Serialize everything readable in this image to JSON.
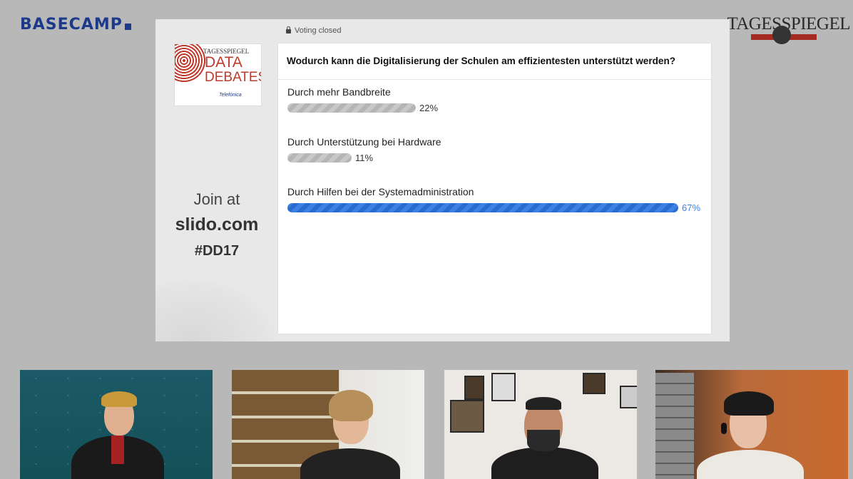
{
  "brand_left": "BASECAMP",
  "brand_right": "TAGESSPIEGEL",
  "slido": {
    "status": "Voting closed",
    "logo": {
      "publisher": "TAGESSPIEGEL",
      "line1": "DATA",
      "line2": "DEBATES",
      "sponsor": "Telefónica"
    },
    "join": {
      "prompt": "Join at",
      "url": "slido.com",
      "code": "#DD17"
    },
    "question": "Wodurch kann die Digitalisierung der Schulen am effizientesten unterstützt werden?",
    "options": [
      {
        "label": "Durch mehr Bandbreite",
        "percent": 22,
        "percent_label": "22%"
      },
      {
        "label": "Durch Unterstützung bei Hardware",
        "percent": 11,
        "percent_label": "11%"
      },
      {
        "label": "Durch Hilfen bei der Systemadministration",
        "percent": 67,
        "percent_label": "67%"
      }
    ],
    "colors": {
      "winner": "#3b82e6",
      "other": "#c4c4c4"
    }
  },
  "participants": [
    {
      "tile": "participant-1"
    },
    {
      "tile": "participant-2"
    },
    {
      "tile": "participant-3"
    },
    {
      "tile": "participant-4"
    }
  ]
}
